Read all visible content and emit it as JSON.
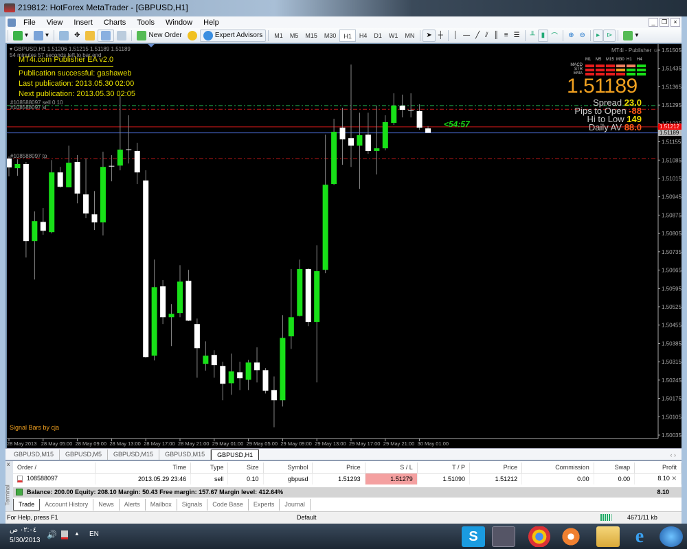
{
  "window": {
    "title": "219812: HotForex MetaTrader - [GBPUSD,H1]"
  },
  "menu": [
    "File",
    "View",
    "Insert",
    "Charts",
    "Tools",
    "Window",
    "Help"
  ],
  "toolbar": {
    "new_order": "New Order",
    "expert_advisors": "Expert Advisors",
    "timeframes": [
      "M1",
      "M5",
      "M15",
      "M30",
      "H1",
      "H4",
      "D1",
      "W1",
      "MN"
    ],
    "active_timeframe": "H1"
  },
  "chart": {
    "header": "GBPUSD,H1  1.51206 1.51215 1.51189 1.51189",
    "timer": "54 minutes 57 seconds left to bar end",
    "publisher_title": "MT4i.com Publisher EA v2.0",
    "pub_status": "Publication successful: gashaweb",
    "last_pub": "Last publication: 2013.05.30 02:00",
    "next_pub": "Next publication: 2013.05.30 02:05",
    "order_label_open": "#108588097 sell 0.10",
    "order_label_sl": "#108588097 sl",
    "order_label_tp": "#108588097 tp",
    "countdown": "<54:57",
    "corner_label": "MT4i - Publisher",
    "signal_bars_label": "Signal Bars by cja",
    "big_price": "1.51189",
    "stats": [
      {
        "label": "Spread",
        "value": "23.0",
        "color": "#f0e000"
      },
      {
        "label": "Pips to Open",
        "value": "-88",
        "color": "#ff5a1a"
      },
      {
        "label": "Hi to Low",
        "value": "149",
        "color": "#f0e000"
      },
      {
        "label": "Daily AV",
        "value": "88.0",
        "color": "#ff5a1a"
      }
    ],
    "signal_grid": {
      "columns": [
        "M1",
        "M5",
        "M15",
        "M30",
        "H1",
        "H4"
      ],
      "rows": [
        {
          "name": "MACD",
          "colors": [
            "#e81c1c",
            "#e81c1c",
            "#e81c1c",
            "#f08060",
            "#f08060",
            "#18e018"
          ]
        },
        {
          "name": "STR",
          "colors": [
            "#e81c1c",
            "#e81c1c",
            "#e81c1c",
            "#f0a020",
            "#18e018",
            "#18e018"
          ]
        },
        {
          "name": "EMA",
          "colors": [
            "#e81c1c",
            "#e81c1c",
            "#e81c1c",
            "#e81c1c",
            "#18e018",
            "#18e018"
          ]
        }
      ]
    },
    "price_tags": {
      "ask": "1.51212",
      "bid": "1.51189"
    }
  },
  "chart_data": {
    "type": "candlestick",
    "symbol": "GBPUSD",
    "timeframe": "H1",
    "ylim": [
      1.50035,
      1.51505
    ],
    "y_ticks": [
      "1.51505",
      "1.51435",
      "1.51365",
      "1.51295",
      "1.51225",
      "1.51155",
      "1.51085",
      "1.51015",
      "1.50945",
      "1.50875",
      "1.50805",
      "1.50735",
      "1.50665",
      "1.50595",
      "1.50525",
      "1.50455",
      "1.50385",
      "1.50315",
      "1.50245",
      "1.50175",
      "1.50105",
      "1.50035"
    ],
    "x_ticks": [
      "28 May 2013",
      "28 May 05:00",
      "28 May 09:00",
      "28 May 13:00",
      "28 May 17:00",
      "28 May 21:00",
      "29 May 01:00",
      "29 May 05:00",
      "29 May 09:00",
      "29 May 13:00",
      "29 May 17:00",
      "29 May 21:00",
      "30 May 01:00"
    ],
    "lines": {
      "order_open": 1.51293,
      "stop_loss": 1.51279,
      "take_profit": 1.5109,
      "ask": 1.51212,
      "bid": 1.51189
    },
    "ohlc": [
      [
        1.51091,
        1.51099,
        1.51023,
        1.51057
      ],
      [
        1.51054,
        1.51088,
        1.51025,
        1.5107
      ],
      [
        1.5107,
        1.51078,
        1.50713,
        1.50776
      ],
      [
        1.50776,
        1.50889,
        1.50629,
        1.50852
      ],
      [
        1.50849,
        1.50902,
        1.508,
        1.50815
      ],
      [
        1.5081,
        1.51085,
        1.50805,
        1.51038
      ],
      [
        1.51038,
        1.51059,
        1.5098,
        1.50983
      ],
      [
        1.50981,
        1.5114,
        1.50981,
        1.51075
      ],
      [
        1.51078,
        1.51104,
        1.5092,
        1.50957
      ],
      [
        1.50954,
        1.51091,
        1.50863,
        1.50881
      ],
      [
        1.50878,
        1.50967,
        1.50818,
        1.50847
      ],
      [
        1.50847,
        1.51117,
        1.50797,
        1.51059
      ],
      [
        1.51063,
        1.51104,
        1.51004,
        1.51061
      ],
      [
        1.51064,
        1.51329,
        1.51046,
        1.51125
      ],
      [
        1.51126,
        1.51256,
        1.51072,
        1.51124
      ],
      [
        1.5112,
        1.51151,
        1.50994,
        1.51038
      ],
      [
        1.51007,
        1.51046,
        1.5033,
        1.50333
      ],
      [
        1.50338,
        1.50705,
        1.5032,
        1.506
      ],
      [
        1.50603,
        1.50627,
        1.50459,
        1.50485
      ],
      [
        1.50485,
        1.50535,
        1.50375,
        1.50498
      ],
      [
        1.50501,
        1.50684,
        1.50485,
        1.50621
      ],
      [
        1.50624,
        1.50666,
        1.5047,
        1.50472
      ],
      [
        1.50459,
        1.5048,
        1.50254,
        1.50367
      ],
      [
        1.50307,
        1.50393,
        1.50281,
        1.50338
      ],
      [
        1.50341,
        1.50359,
        1.50254,
        1.50302
      ],
      [
        1.50299,
        1.50315,
        1.50168,
        1.50231
      ],
      [
        1.50233,
        1.50346,
        1.50189,
        1.50278
      ],
      [
        1.50275,
        1.50315,
        1.50207,
        1.50252
      ],
      [
        1.50246,
        1.50322,
        1.50207,
        1.50312
      ],
      [
        1.50312,
        1.5037,
        1.50236,
        1.50283
      ],
      [
        1.50283,
        1.50291,
        1.50194,
        1.50204
      ],
      [
        1.50207,
        1.50259,
        1.50065,
        1.50168
      ],
      [
        1.50168,
        1.50493,
        1.50144,
        1.50406
      ],
      [
        1.50412,
        1.50669,
        1.50364,
        1.50485
      ],
      [
        1.5049,
        1.50705,
        1.50488,
        1.50669
      ],
      [
        1.50669,
        1.50672,
        1.50451,
        1.50467
      ],
      [
        1.50467,
        1.5076,
        1.50236,
        1.50661
      ],
      [
        1.50666,
        1.51182,
        1.50653,
        1.50991
      ],
      [
        1.50994,
        1.51243,
        1.5099,
        1.51193
      ],
      [
        1.51209,
        1.51285,
        1.51067,
        1.51164
      ],
      [
        1.51169,
        1.5145,
        1.51059,
        1.5114
      ],
      [
        1.5114,
        1.51266,
        1.50975,
        1.5118
      ],
      [
        1.51182,
        1.51266,
        1.51109,
        1.5112
      ],
      [
        1.5112,
        1.51293,
        1.5103,
        1.5113
      ],
      [
        1.5113,
        1.51256,
        1.51122,
        1.5123
      ],
      [
        1.51227,
        1.5134,
        1.51219,
        1.51293
      ],
      [
        1.51293,
        1.51335,
        1.51248,
        1.51277
      ],
      [
        1.51277,
        1.5134,
        1.51248,
        1.51276
      ],
      [
        1.51272,
        1.51298,
        1.51201,
        1.51209
      ],
      [
        1.51206,
        1.51215,
        1.51189,
        1.51189
      ]
    ]
  },
  "chart_tabs": [
    "GBPUSD,M15",
    "GBPUSD,M5",
    "GBPUSD,M15",
    "GBPUSD,M15",
    "GBPUSD,H1"
  ],
  "terminal": {
    "side_label": "Terminal",
    "columns": [
      "Order  /",
      "Time",
      "Type",
      "Size",
      "Symbol",
      "Price",
      "S / L",
      "T / P",
      "Price",
      "Commission",
      "Swap",
      "Profit"
    ],
    "row": [
      "108588097",
      "2013.05.29 23:46",
      "sell",
      "0.10",
      "gbpusd",
      "1.51293",
      "1.51279",
      "1.51090",
      "1.51212",
      "0.00",
      "0.00",
      "8.10"
    ],
    "balance": "Balance: 200.00  Equity: 208.10  Margin: 50.43  Free margin: 157.67  Margin level: 412.64%",
    "balance_profit": "8.10",
    "tabs": [
      "Trade",
      "Account History",
      "News",
      "Alerts",
      "Mailbox",
      "Signals",
      "Code Base",
      "Experts",
      "Journal"
    ]
  },
  "status": {
    "help": "For Help, press F1",
    "profile": "Default",
    "traffic": "4671/11 kb"
  },
  "taskbar": {
    "time": "٠٢:٠٤ ص",
    "date": "5/30/2013",
    "lang": "EN"
  }
}
